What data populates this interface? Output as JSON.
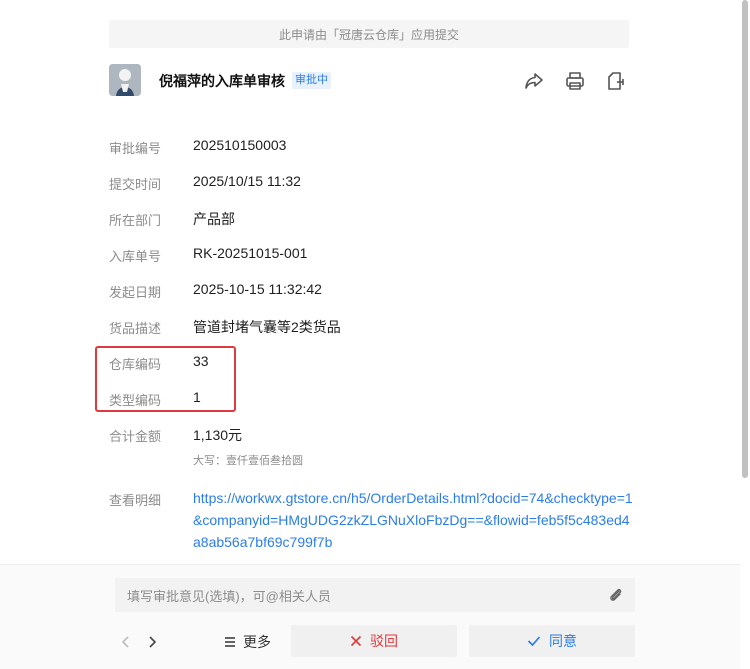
{
  "banner": "此申请由「冠唐云仓库」应用提交",
  "header": {
    "title": "倪福萍的入库单审核",
    "status_badge": "审批中",
    "icons": [
      "share-icon",
      "print-icon",
      "export-icon"
    ]
  },
  "fields": [
    {
      "label": "审批编号",
      "value": "202510150003"
    },
    {
      "label": "提交时间",
      "value": "2025/10/15 11:32"
    },
    {
      "label": "所在部门",
      "value": "产品部"
    },
    {
      "label": "入库单号",
      "value": "RK-20251015-001"
    },
    {
      "label": "发起日期",
      "value": "2025-10-15 11:32:42"
    },
    {
      "label": "货品描述",
      "value": "管道封堵气囊等2类货品"
    },
    {
      "label": "仓库编码",
      "value": "33"
    },
    {
      "label": "类型编码",
      "value": "1"
    },
    {
      "label": "合计金额",
      "value": "1,130元"
    }
  ],
  "amount_capital": "大写：壹仟壹佰叁拾圆",
  "detail": {
    "label": "查看明细",
    "link": "https://workwx.gtstore.cn/h5/OrderDetails.html?docid=74&checktype=1&companyid=HMgUDG2zkZLGNuXloFbzDg==&flowid=feb5f5c483ed4a8ab56a7bf69c799f7b"
  },
  "footer": {
    "comment_placeholder": "填写审批意见(选填)，可@相关人员",
    "more_label": "更多",
    "reject_label": "驳回",
    "approve_label": "同意"
  },
  "colors": {
    "accent": "#2b7de9",
    "reject": "#e0393e",
    "highlight": "#e0393e"
  }
}
